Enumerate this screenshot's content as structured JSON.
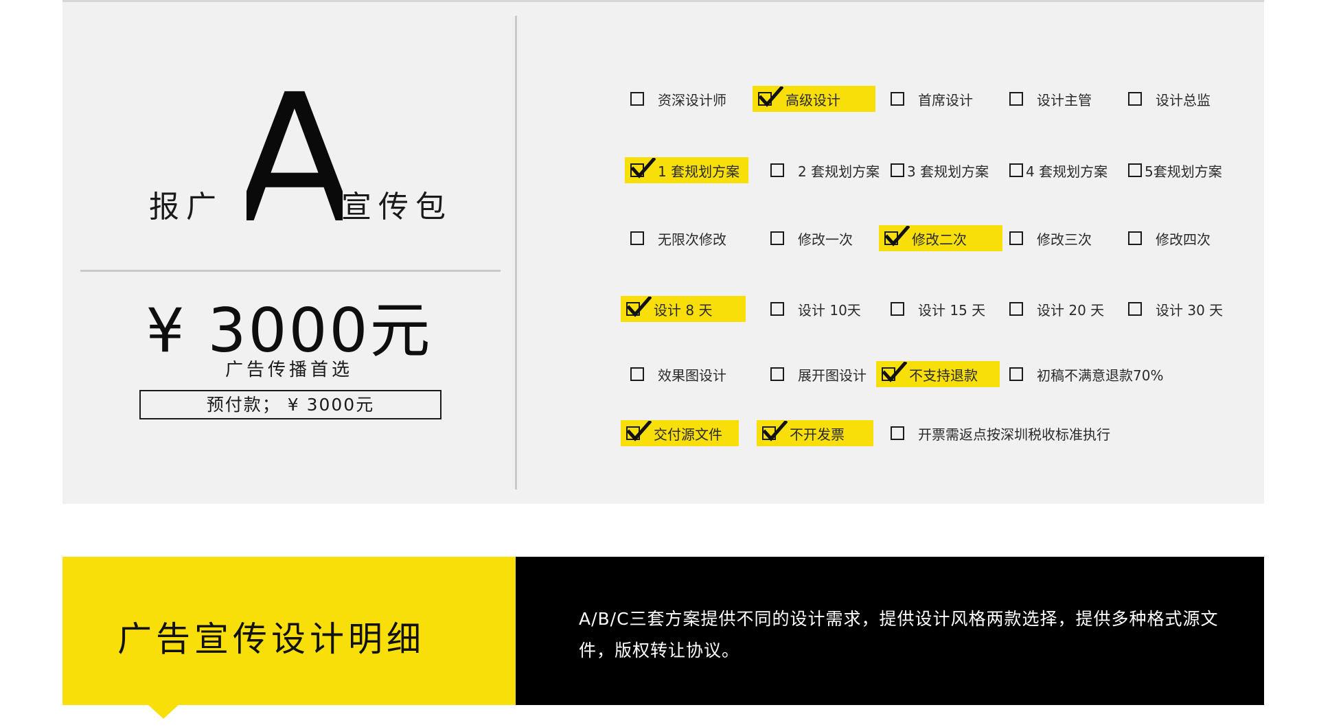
{
  "package": {
    "title_prefix": "报广",
    "title_letter": "A",
    "title_suffix": "宣传包",
    "price": "¥ 3000元",
    "tagline": "广告传播首选",
    "prepay": "预付款；  ¥ 3000元"
  },
  "options": {
    "rows": [
      [
        {
          "label": "资深设计师",
          "checked": false
        },
        {
          "label": "高级设计",
          "checked": true
        },
        {
          "label": "首席设计",
          "checked": false
        },
        {
          "label": "设计主管",
          "checked": false
        },
        {
          "label": "设计总监",
          "checked": false
        }
      ],
      [
        {
          "label": "1 套规划方案",
          "checked": true
        },
        {
          "label": "2 套规划方案",
          "checked": false
        },
        {
          "label": "3 套规划方案",
          "checked": false
        },
        {
          "label": "4 套规划方案",
          "checked": false
        },
        {
          "label": "5套规划方案",
          "checked": false
        }
      ],
      [
        {
          "label": "无限次修改",
          "checked": false
        },
        {
          "label": "修改一次",
          "checked": false
        },
        {
          "label": "修改二次",
          "checked": true
        },
        {
          "label": "修改三次",
          "checked": false
        },
        {
          "label": "修改四次",
          "checked": false
        }
      ],
      [
        {
          "label": "设计 8 天",
          "checked": true
        },
        {
          "label": "设计 10天",
          "checked": false
        },
        {
          "label": "设计 15 天",
          "checked": false
        },
        {
          "label": "设计 20 天",
          "checked": false
        },
        {
          "label": "设计 30 天",
          "checked": false
        }
      ],
      [
        {
          "label": "效果图设计",
          "checked": false
        },
        {
          "label": "展开图设计",
          "checked": false
        },
        {
          "label": "不支持退款",
          "checked": true
        },
        {
          "label": "初稿不满意退款70%",
          "checked": false
        }
      ],
      [
        {
          "label": "交付源文件",
          "checked": true
        },
        {
          "label": "不开发票",
          "checked": true
        },
        {
          "label": "开票需返点按深圳税收标准执行",
          "checked": false
        }
      ]
    ]
  },
  "banner": {
    "title": "广告宣传设计明细",
    "description": "A/B/C三套方案提供不同的设计需求，提供设计风格两款选择，提供多种格式源文件，版权转让协议。"
  },
  "colors": {
    "accent_yellow": "#f9df0a",
    "panel_bg": "#f1f1f1",
    "banner_black": "#000000",
    "text_dark": "#1a1a1a"
  },
  "icons": {
    "checkbox": "checkbox-icon",
    "checkmark": "checkmark-icon",
    "pointer": "triangle-down-icon"
  }
}
